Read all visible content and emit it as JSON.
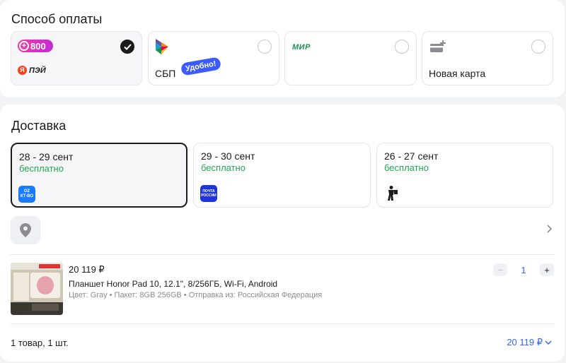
{
  "payment": {
    "title": "Способ оплаты",
    "options": [
      {
        "logo_text": "800",
        "sub_logo": "ПЭЙ",
        "sub_logo_mark": "Я",
        "selected": true
      },
      {
        "label": "СБП",
        "badge": "Удобно!",
        "selected": false
      },
      {
        "logo_text": "МИР",
        "selected": false
      },
      {
        "label": "Новая карта",
        "selected": false
      }
    ]
  },
  "delivery": {
    "title": "Доставка",
    "options": [
      {
        "date": "28 - 29 сент",
        "price": "бесплатно",
        "logo": "ozon-delivery-icon",
        "logo_text": "OZ\nКТ-ВО",
        "selected": true
      },
      {
        "date": "29 - 30 сент",
        "price": "бесплатно",
        "logo": "pochta-rossii-icon",
        "logo_text": "ПОЧТА\nРОССИИ",
        "selected": false
      },
      {
        "date": "26 - 27 сент",
        "price": "бесплатно",
        "logo": "courier-icon",
        "selected": false
      }
    ]
  },
  "product": {
    "price": "20 119 ₽",
    "title": "Планшет Honor Pad 10, 12.1\", 8/256ГБ, Wi-Fi, Android",
    "meta": "Цвет: Gray • Пакет: 8GB 256GB • Отправка из: Российская Федерация",
    "quantity": "1",
    "minus": "−",
    "plus": "+"
  },
  "summary": {
    "items": "1 товар, 1 шт.",
    "total": "20 119 ₽"
  },
  "colors": {
    "accent": "#3566ff",
    "green": "#1ea94f",
    "selected_border": "#1b1b1b"
  }
}
